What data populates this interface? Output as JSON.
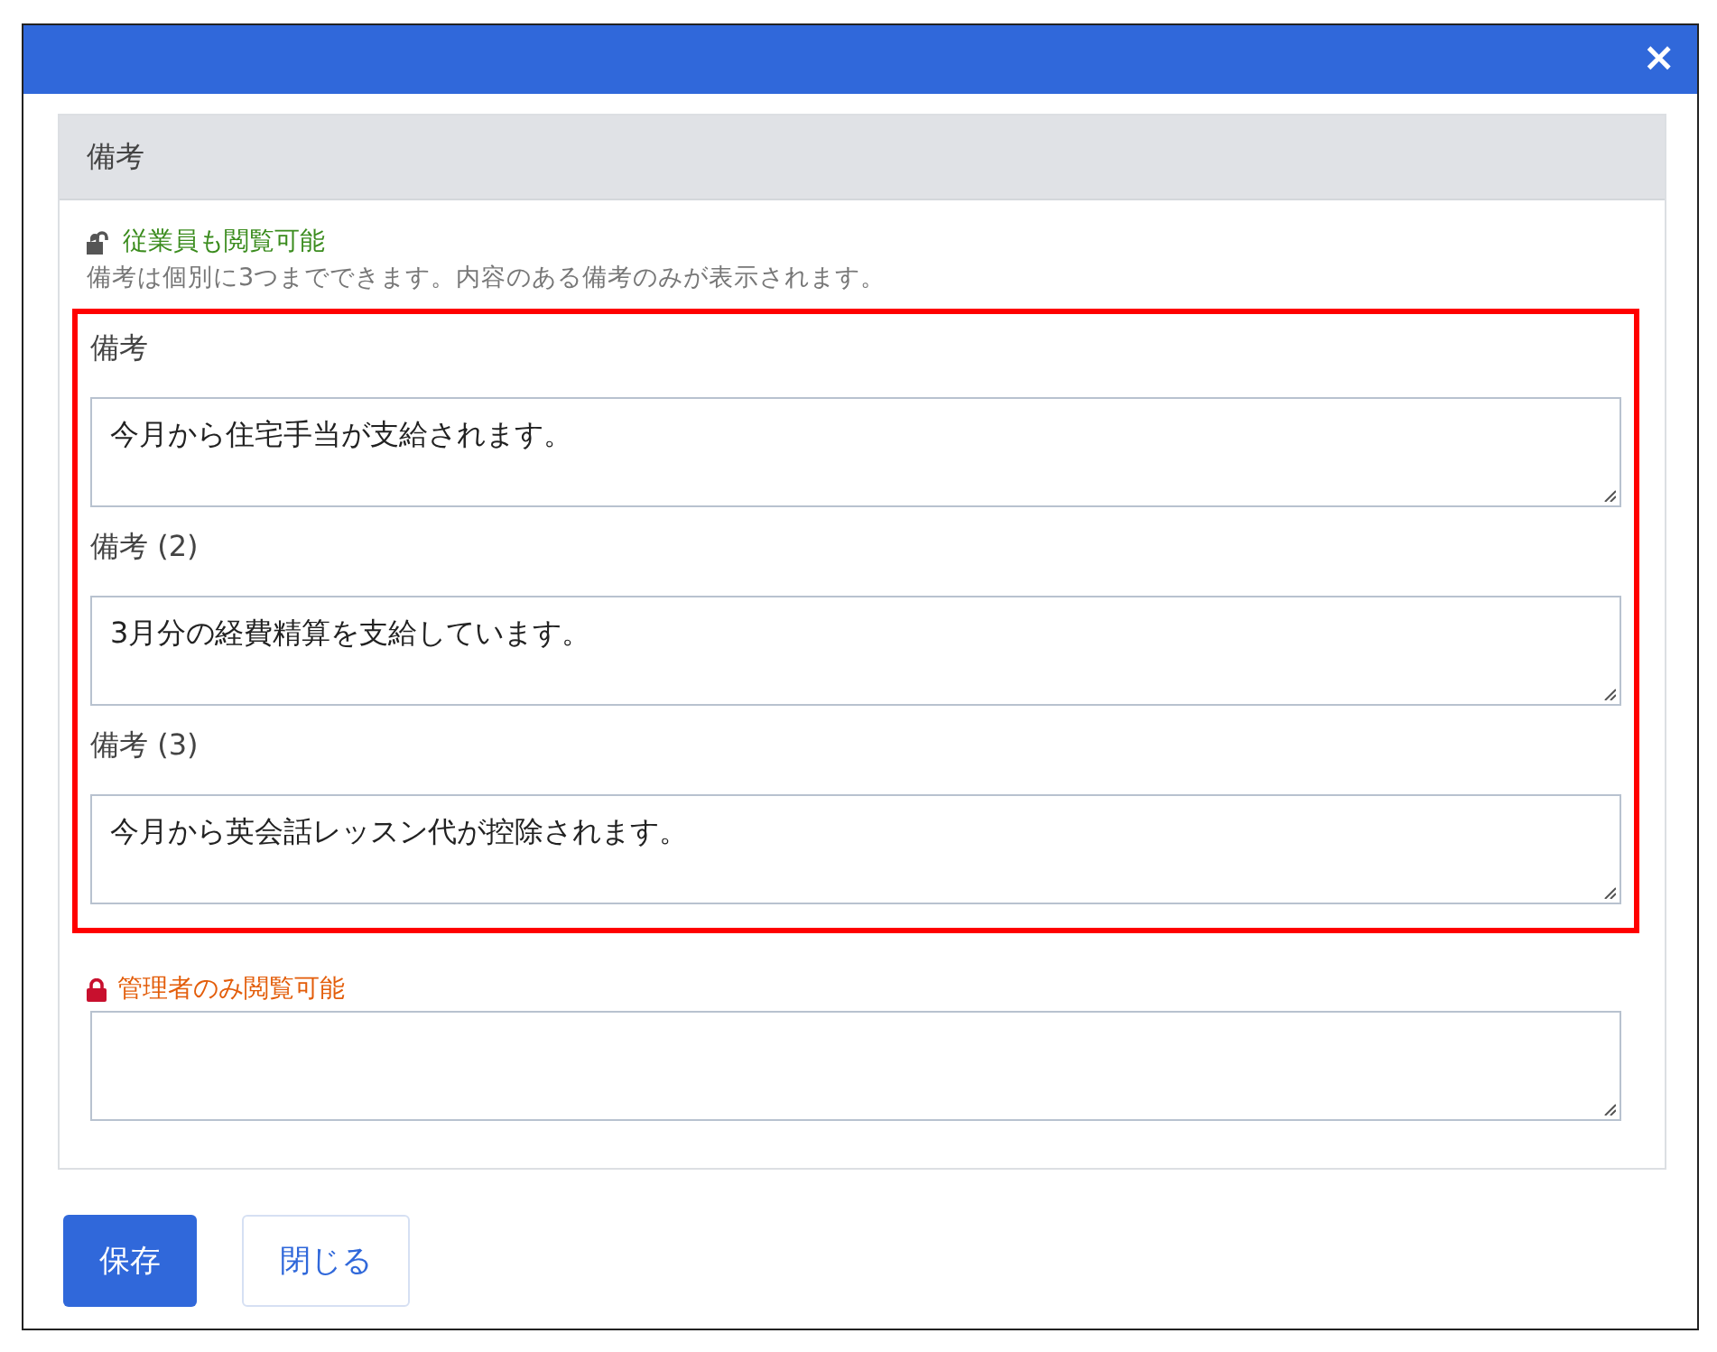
{
  "dialog": {
    "close_icon": "×"
  },
  "panel": {
    "title": "備考",
    "groups": [
      {
        "kind": "public",
        "label": "従業員も閲覧可能",
        "note": "備考は個別に3つまでできます。内容のある備考のみが表示されます。",
        "highlighted": true,
        "fields": [
          {
            "kind": "textarea",
            "label": "備考",
            "value": "今月から住宅手当が支給されます。"
          },
          {
            "kind": "textarea",
            "label": "備考 (2)",
            "value": "3月分の経費精算を支給しています。"
          },
          {
            "kind": "textarea",
            "label": "備考 (3)",
            "value": "今月から英会話レッスン代が控除されます。"
          }
        ]
      },
      {
        "kind": "private",
        "label": "管理者のみ閲覧可能",
        "highlighted": false,
        "fields": [
          {
            "kind": "textarea"
          }
        ]
      }
    ]
  },
  "buttons": [
    {
      "kind": "primary",
      "label": "保存"
    },
    {
      "kind": "secondary",
      "label": "閉じる"
    }
  ]
}
